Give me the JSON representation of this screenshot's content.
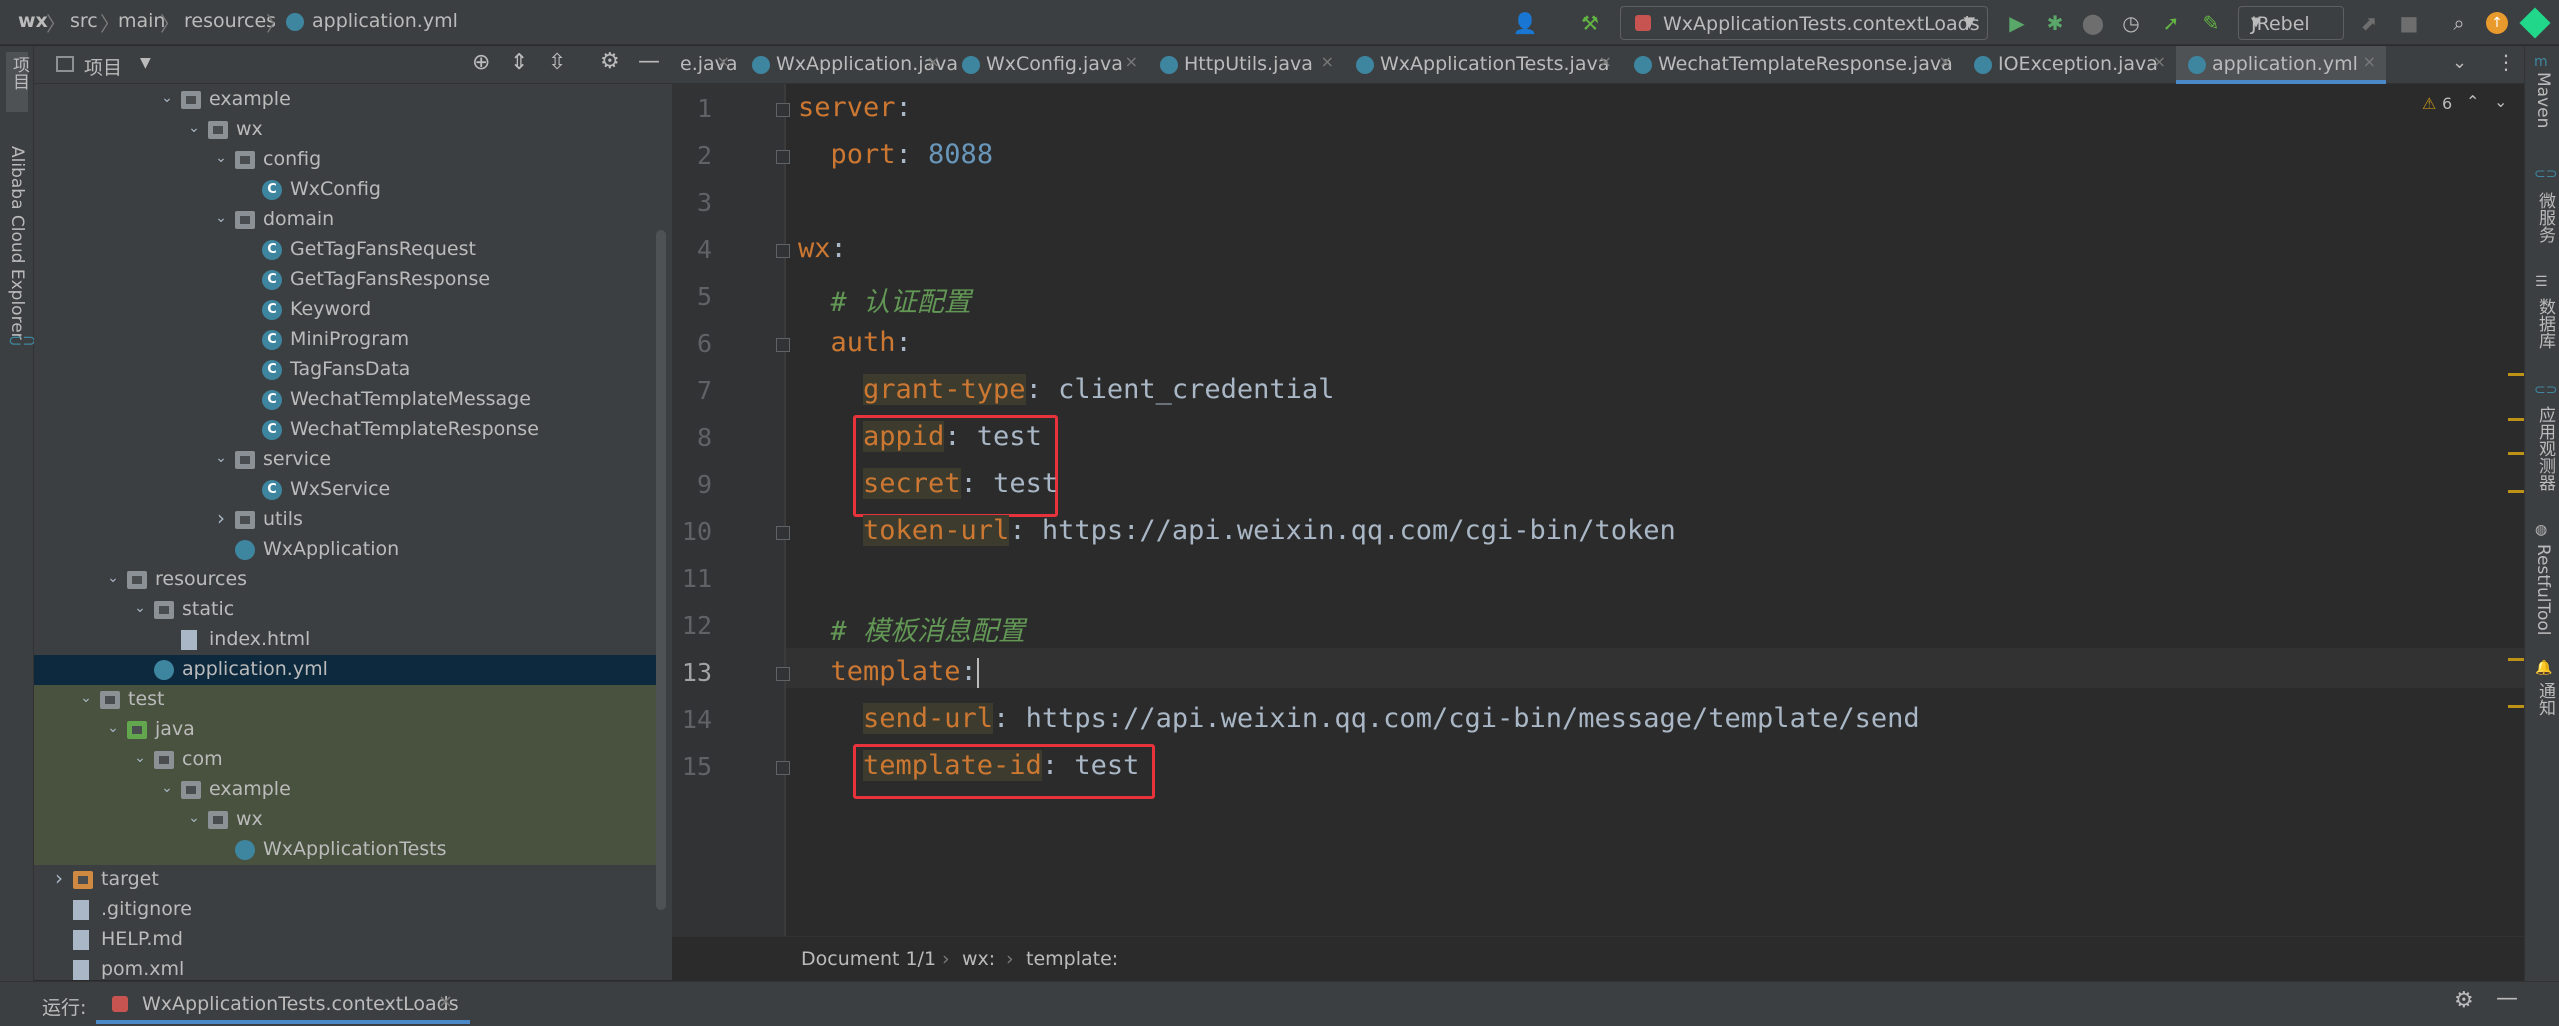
{
  "breadcrumb": [
    "wx",
    "src",
    "main",
    "resources",
    "application.yml"
  ],
  "toolbar": {
    "run_config": "WxApplicationTests.contextLoads",
    "jrebel": "JRebel"
  },
  "left_strip": {
    "project": "项目",
    "alibaba": "Alibaba Cloud Explorer"
  },
  "project_panel": {
    "title": "项目"
  },
  "tree": [
    {
      "label": "example",
      "kind": "folder",
      "depth": 5,
      "expanded": true
    },
    {
      "label": "wx",
      "kind": "folder",
      "depth": 6,
      "expanded": true
    },
    {
      "label": "config",
      "kind": "folder",
      "depth": 7,
      "expanded": true
    },
    {
      "label": "WxConfig",
      "kind": "class",
      "depth": 8
    },
    {
      "label": "domain",
      "kind": "folder",
      "depth": 7,
      "expanded": true
    },
    {
      "label": "GetTagFansRequest",
      "kind": "class",
      "depth": 8
    },
    {
      "label": "GetTagFansResponse",
      "kind": "class",
      "depth": 8
    },
    {
      "label": "Keyword",
      "kind": "class",
      "depth": 8
    },
    {
      "label": "MiniProgram",
      "kind": "class",
      "depth": 8
    },
    {
      "label": "TagFansData",
      "kind": "class",
      "depth": 8
    },
    {
      "label": "WechatTemplateMessage",
      "kind": "class",
      "depth": 8
    },
    {
      "label": "WechatTemplateResponse",
      "kind": "class",
      "depth": 8
    },
    {
      "label": "service",
      "kind": "folder",
      "depth": 7,
      "expanded": true
    },
    {
      "label": "WxService",
      "kind": "class",
      "depth": 8
    },
    {
      "label": "utils",
      "kind": "folder",
      "depth": 7,
      "expanded": false
    },
    {
      "label": "WxApplication",
      "kind": "spring",
      "depth": 7
    },
    {
      "label": "resources",
      "kind": "folder",
      "depth": 3,
      "expanded": true
    },
    {
      "label": "static",
      "kind": "folder",
      "depth": 4,
      "expanded": true
    },
    {
      "label": "index.html",
      "kind": "file",
      "depth": 5
    },
    {
      "label": "application.yml",
      "kind": "spring",
      "depth": 4,
      "selected": true
    },
    {
      "label": "test",
      "kind": "folder",
      "depth": 2,
      "expanded": true,
      "test": true
    },
    {
      "label": "java",
      "kind": "folder-src",
      "depth": 3,
      "expanded": true,
      "test": true
    },
    {
      "label": "com",
      "kind": "folder",
      "depth": 4,
      "expanded": true,
      "test": true
    },
    {
      "label": "example",
      "kind": "folder",
      "depth": 5,
      "expanded": true,
      "test": true
    },
    {
      "label": "wx",
      "kind": "folder",
      "depth": 6,
      "expanded": true,
      "test": true
    },
    {
      "label": "WxApplicationTests",
      "kind": "spring",
      "depth": 7,
      "test": true
    },
    {
      "label": "target",
      "kind": "folder-orange",
      "depth": 1,
      "expanded": false
    },
    {
      "label": ".gitignore",
      "kind": "file",
      "depth": 1
    },
    {
      "label": "HELP.md",
      "kind": "file",
      "depth": 1
    },
    {
      "label": "pom.xml",
      "kind": "file",
      "depth": 1
    }
  ],
  "tabs": [
    {
      "label": "e.java",
      "active": false,
      "icon": false
    },
    {
      "label": "WxApplication.java",
      "active": false,
      "icon": true
    },
    {
      "label": "WxConfig.java",
      "active": false,
      "icon": true
    },
    {
      "label": "HttpUtils.java",
      "active": false,
      "icon": true
    },
    {
      "label": "WxApplicationTests.java",
      "active": false,
      "icon": true
    },
    {
      "label": "WechatTemplateResponse.java",
      "active": false,
      "icon": true
    },
    {
      "label": "IOException.java",
      "active": false,
      "icon": true
    },
    {
      "label": "application.yml",
      "active": true,
      "icon": true
    }
  ],
  "editor": {
    "warnings": "6",
    "current_line": 13,
    "lines": [
      {
        "n": "1",
        "key": "server",
        "indent": 0
      },
      {
        "n": "2",
        "key": "port",
        "indent": 1,
        "value": "8088",
        "numeric": true
      },
      {
        "n": "3"
      },
      {
        "n": "4",
        "key": "wx",
        "indent": 0
      },
      {
        "n": "5",
        "comment": "# 认证配置",
        "indent": 1
      },
      {
        "n": "6",
        "key": "auth",
        "indent": 1
      },
      {
        "n": "7",
        "key": "grant-type",
        "indent": 2,
        "value": "client_credential"
      },
      {
        "n": "8",
        "key": "appid",
        "indent": 2,
        "value": "test"
      },
      {
        "n": "9",
        "key": "secret",
        "indent": 2,
        "value": "test"
      },
      {
        "n": "10",
        "key": "token-url",
        "indent": 2,
        "value": "https://api.weixin.qq.com/cgi-bin/token"
      },
      {
        "n": "11"
      },
      {
        "n": "12",
        "comment": "# 模板消息配置",
        "indent": 1
      },
      {
        "n": "13",
        "key": "template",
        "indent": 1
      },
      {
        "n": "14",
        "key": "send-url",
        "indent": 2,
        "value": "https://api.weixin.qq.com/cgi-bin/message/template/send"
      },
      {
        "n": "15",
        "key": "template-id",
        "indent": 2,
        "value": "test"
      }
    ]
  },
  "editor_breadcrumb": [
    "Document 1/1",
    "wx:",
    "template:"
  ],
  "right_strip": [
    "Maven",
    "微服务",
    "数据库",
    "应用观测器",
    "RestfulTool",
    "通知"
  ],
  "run_bar": {
    "label": "运行:",
    "config": "WxApplicationTests.contextLoads"
  },
  "colors": {
    "keyword": "#cc7832",
    "comment": "#629755",
    "number": "#6897bb",
    "highlight_box": "#e8323c",
    "accent": "#4a88c7"
  }
}
